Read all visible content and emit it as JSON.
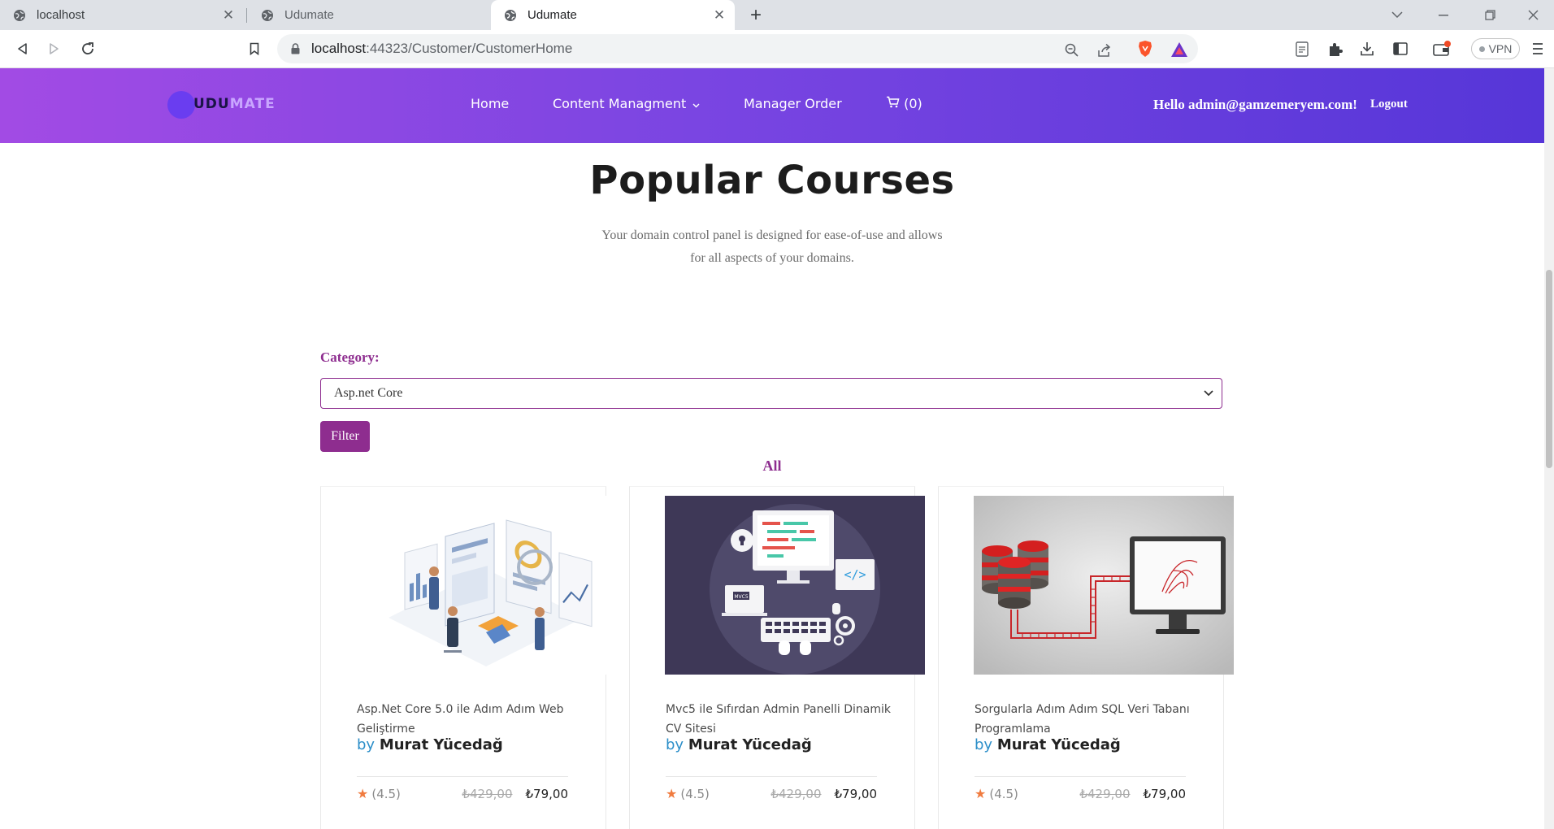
{
  "browser": {
    "tabs": [
      {
        "title": "localhost",
        "active": false
      },
      {
        "title": "Udumate",
        "active": false
      },
      {
        "title": "Udumate",
        "active": true
      }
    ],
    "url_host": "localhost",
    "url_rest": ":44323/Customer/CustomerHome",
    "vpn_label": "VPN"
  },
  "site": {
    "logo_part1": "UDU",
    "logo_part2": "MATE",
    "nav": {
      "home": "Home",
      "content": "Content Managment",
      "orders": "Manager Order",
      "cart": "(0)"
    },
    "greeting": "Hello admin@gamzemeryem.com!",
    "logout": "Logout"
  },
  "hero": {
    "title": "Popular Courses",
    "subtitle": "Your domain control panel is designed for ease-of-use and allows for all aspects of your domains."
  },
  "filter": {
    "label": "Category:",
    "selected": "Asp.net Core",
    "button": "Filter",
    "all_link": "All"
  },
  "courses": [
    {
      "title": "Asp.Net Core 5.0 ile Adım Adım Web Geliştirme",
      "by": "by",
      "author": "Murat Yücedağ",
      "rating": "(4.5)",
      "old_price": "₺429,00",
      "price": "₺79,00",
      "image": "isometric-analytics-illustration"
    },
    {
      "title": "Mvc5 ile Sıfırdan Admin Panelli Dinamik CV Sitesi",
      "by": "by",
      "author": "Murat Yücedağ",
      "rating": "(4.5)",
      "old_price": "₺429,00",
      "price": "₺79,00",
      "image": "mvc-coding-illustration"
    },
    {
      "title": "Sorgularla Adım Adım SQL Veri Tabanı Programlama",
      "by": "by",
      "author": "Murat Yücedağ",
      "rating": "(4.5)",
      "old_price": "₺429,00",
      "price": "₺79,00",
      "image": "sql-database-illustration"
    }
  ],
  "colors": {
    "header_start": "#a24be4",
    "header_end": "#5636d8",
    "accent": "#8e2d8f",
    "author_by": "#2d8fc9",
    "star": "#f07b3f"
  }
}
